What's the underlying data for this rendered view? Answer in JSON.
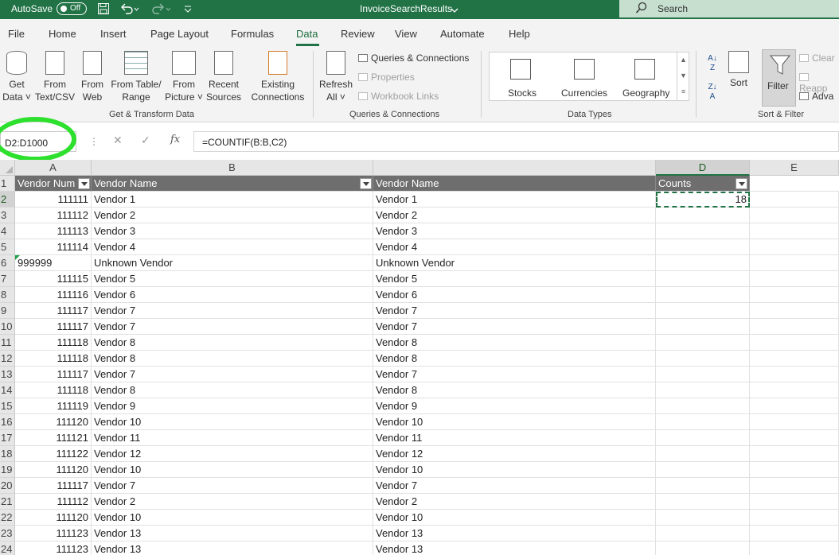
{
  "titlebar": {
    "autosave_label": "AutoSave",
    "autosave_state": "Off",
    "filename": "InvoiceSearchResults",
    "search_placeholder": "Search"
  },
  "menu": {
    "tabs": [
      "File",
      "Home",
      "Insert",
      "Page Layout",
      "Formulas",
      "Data",
      "Review",
      "View",
      "Automate",
      "Help"
    ],
    "active": "Data"
  },
  "ribbon": {
    "get_transform": {
      "buttons": [
        {
          "line1": "Get",
          "line2": "Data ˅"
        },
        {
          "line1": "From",
          "line2": "Text/CSV"
        },
        {
          "line1": "From",
          "line2": "Web"
        },
        {
          "line1": "From Table/",
          "line2": "Range"
        },
        {
          "line1": "From",
          "line2": "Picture ˅"
        },
        {
          "line1": "Recent",
          "line2": "Sources"
        },
        {
          "line1": "Existing",
          "line2": "Connections"
        }
      ],
      "label": "Get & Transform Data"
    },
    "queries": {
      "refresh_line1": "Refresh",
      "refresh_line2": "All ˅",
      "items": [
        "Queries & Connections",
        "Properties",
        "Workbook Links"
      ],
      "label": "Queries & Connections"
    },
    "data_types": {
      "items": [
        "Stocks",
        "Currencies",
        "Geography"
      ],
      "label": "Data Types"
    },
    "sort_filter": {
      "sort": "Sort",
      "filter": "Filter",
      "clear": "Clear",
      "reapply": "Reapp",
      "advanced": "Adva",
      "label": "Sort & Filter"
    }
  },
  "formula_bar": {
    "name_box": "D2:D1000",
    "formula": "=COUNTIF(B:B,C2)",
    "fx": "fx"
  },
  "grid": {
    "columns": [
      "A",
      "B",
      "",
      "D",
      "E"
    ],
    "selected_column": "D",
    "header_row": {
      "a": "Vendor Num",
      "b": "Vendor Name",
      "c": "Vendor Name",
      "d": "Counts"
    },
    "rows": [
      {
        "n": "2",
        "a": "111111",
        "b": "Vendor 1",
        "c": "Vendor 1",
        "d": "18"
      },
      {
        "n": "3",
        "a": "111112",
        "b": "Vendor 2",
        "c": "Vendor 2",
        "d": ""
      },
      {
        "n": "4",
        "a": "111113",
        "b": "Vendor 3",
        "c": "Vendor 3",
        "d": ""
      },
      {
        "n": "5",
        "a": "111114",
        "b": "Vendor 4",
        "c": "Vendor 4",
        "d": ""
      },
      {
        "n": "6",
        "a": "999999",
        "b": "Unknown Vendor",
        "c": "Unknown Vendor",
        "d": "",
        "text_number": true
      },
      {
        "n": "7",
        "a": "111115",
        "b": "Vendor 5",
        "c": "Vendor 5",
        "d": ""
      },
      {
        "n": "8",
        "a": "111116",
        "b": "Vendor 6",
        "c": "Vendor 6",
        "d": ""
      },
      {
        "n": "9",
        "a": "111117",
        "b": "Vendor 7",
        "c": "Vendor 7",
        "d": ""
      },
      {
        "n": "10",
        "a": "111117",
        "b": "Vendor 7",
        "c": "Vendor 7",
        "d": ""
      },
      {
        "n": "11",
        "a": "111118",
        "b": "Vendor 8",
        "c": "Vendor 8",
        "d": ""
      },
      {
        "n": "12",
        "a": "111118",
        "b": "Vendor 8",
        "c": "Vendor 8",
        "d": ""
      },
      {
        "n": "13",
        "a": "111117",
        "b": "Vendor 7",
        "c": "Vendor 7",
        "d": ""
      },
      {
        "n": "14",
        "a": "111118",
        "b": "Vendor 8",
        "c": "Vendor 8",
        "d": ""
      },
      {
        "n": "15",
        "a": "111119",
        "b": "Vendor 9",
        "c": "Vendor 9",
        "d": ""
      },
      {
        "n": "16",
        "a": "111120",
        "b": "Vendor 10",
        "c": "Vendor 10",
        "d": ""
      },
      {
        "n": "17",
        "a": "111121",
        "b": "Vendor 11",
        "c": "Vendor 11",
        "d": ""
      },
      {
        "n": "18",
        "a": "111122",
        "b": "Vendor 12",
        "c": "Vendor 12",
        "d": ""
      },
      {
        "n": "19",
        "a": "111120",
        "b": "Vendor 10",
        "c": "Vendor 10",
        "d": ""
      },
      {
        "n": "20",
        "a": "111117",
        "b": "Vendor 7",
        "c": "Vendor 7",
        "d": ""
      },
      {
        "n": "21",
        "a": "111112",
        "b": "Vendor 2",
        "c": "Vendor 2",
        "d": ""
      },
      {
        "n": "22",
        "a": "111120",
        "b": "Vendor 10",
        "c": "Vendor 10",
        "d": ""
      },
      {
        "n": "23",
        "a": "111123",
        "b": "Vendor 13",
        "c": "Vendor 13",
        "d": ""
      },
      {
        "n": "24",
        "a": "111123",
        "b": "Vendor 13",
        "c": "Vendor 13",
        "d": ""
      }
    ]
  },
  "colors": {
    "excel_green": "#217346",
    "highlight_green": "#2ee02e",
    "header_fill": "#6e6e6e"
  }
}
